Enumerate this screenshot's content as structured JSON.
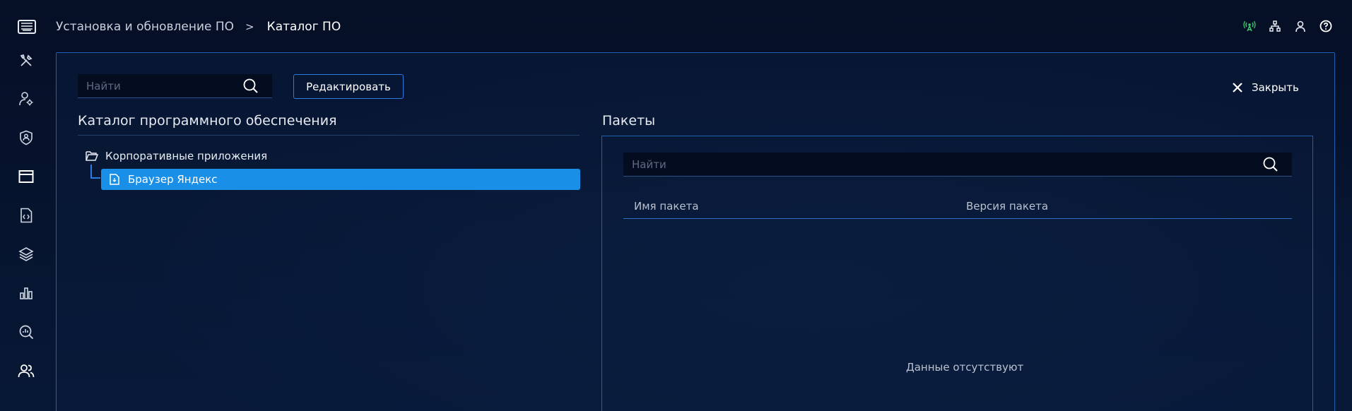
{
  "breadcrumb": {
    "parent": "Установка и обновление ПО",
    "separator": ">",
    "current": "Каталог ПО"
  },
  "top_icons": [
    "broadcast-icon",
    "network-icon",
    "user-icon",
    "help-icon"
  ],
  "sidebar": {
    "items": [
      {
        "icon": "tools-icon"
      },
      {
        "icon": "user-settings-icon"
      },
      {
        "icon": "shield-user-icon"
      },
      {
        "icon": "window-icon",
        "active": true
      },
      {
        "icon": "code-file-icon"
      },
      {
        "icon": "layers-icon"
      },
      {
        "icon": "bar-chart-icon"
      },
      {
        "icon": "search-chart-icon"
      },
      {
        "icon": "users-icon"
      }
    ]
  },
  "toolbar": {
    "search_placeholder": "Найти",
    "edit_label": "Редактировать",
    "close_label": "Закрыть"
  },
  "catalog": {
    "title": "Каталог программного обеспечения",
    "folder": "Корпоративные приложения",
    "selected_item": "Браузер Яндекс"
  },
  "packages": {
    "title": "Пакеты",
    "search_placeholder": "Найти",
    "columns": [
      "Имя пакета",
      "Версия пакета"
    ],
    "empty_text": "Данные отсутствуют"
  },
  "colors": {
    "accent": "#1a8fe8",
    "border": "#1f5fb0",
    "background": "#061430",
    "status_green": "#3ec46d"
  }
}
